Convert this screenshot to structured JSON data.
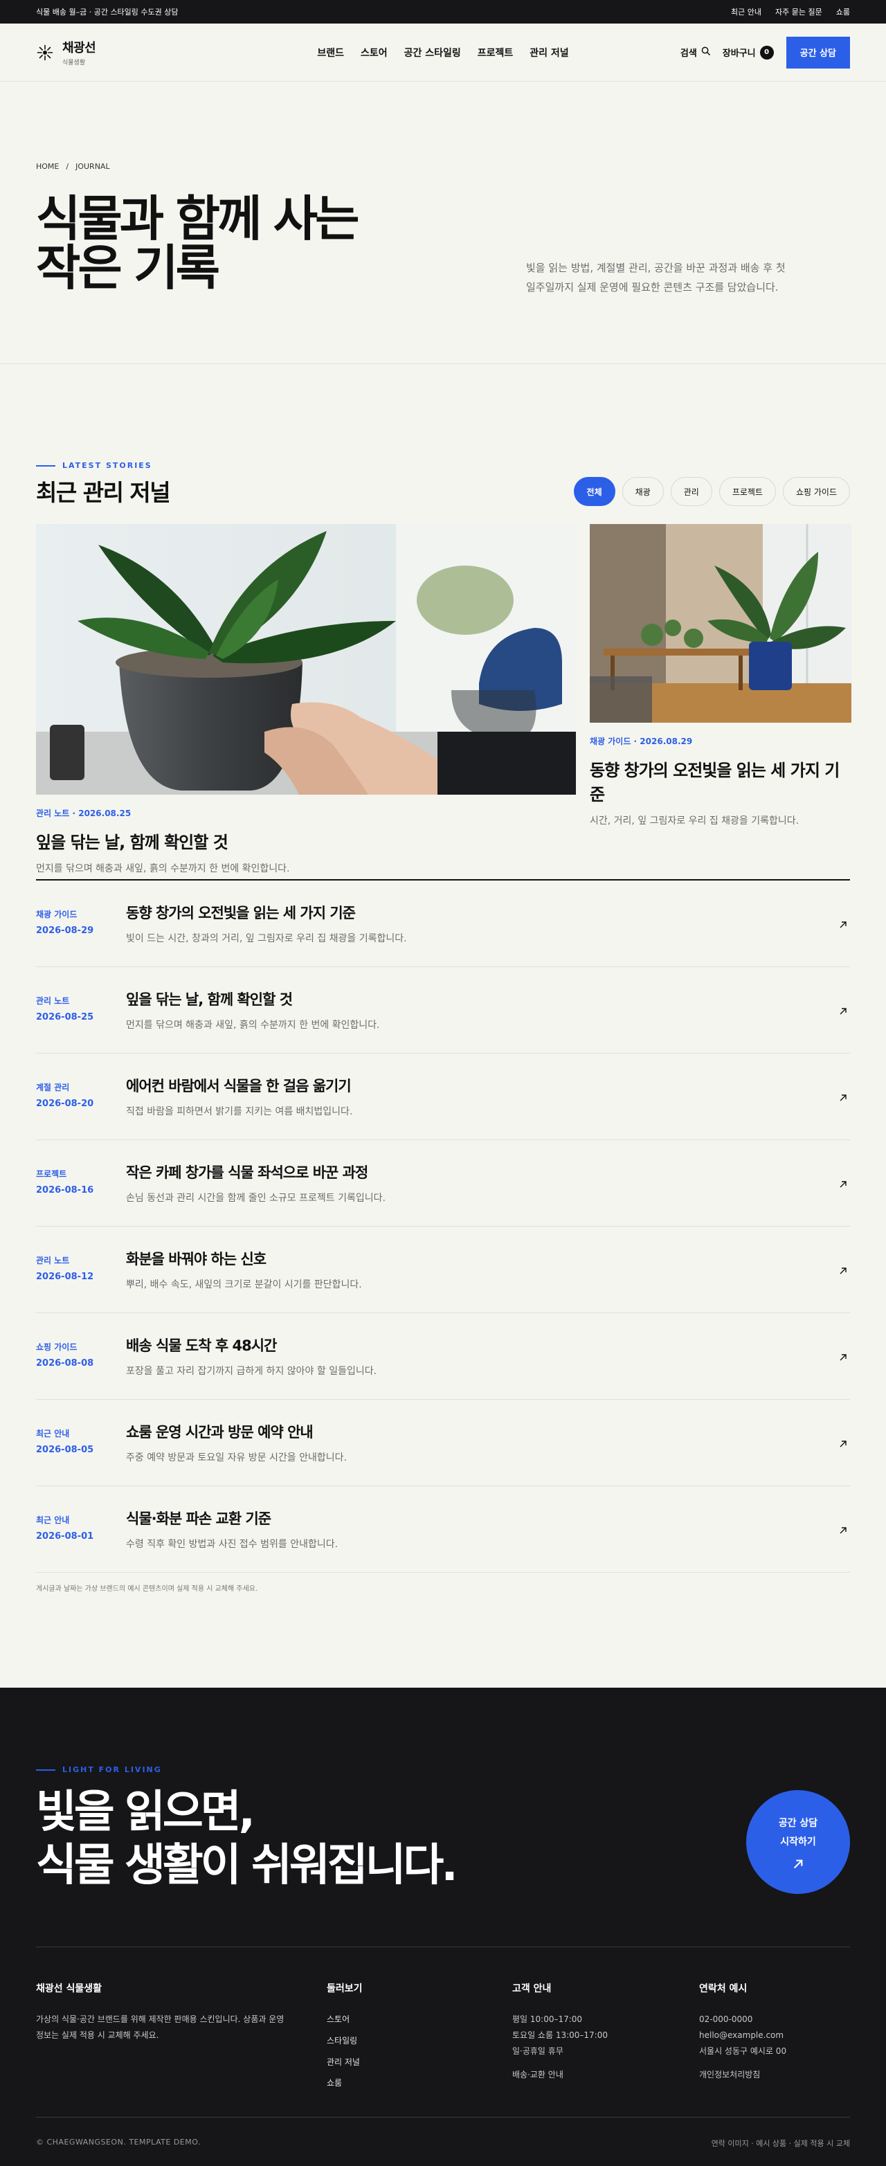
{
  "topbar": {
    "notice": "식물 배송 월–금 · 공간 스타일링 수도권 상담",
    "links": [
      "최근 안내",
      "자주 묻는 질문",
      "쇼룸"
    ]
  },
  "header": {
    "brand": "채광선",
    "brand_sub": "식물생활",
    "nav": [
      "브랜드",
      "스토어",
      "공간 스타일링",
      "프로젝트",
      "관리 저널"
    ],
    "search_label": "검색",
    "cart_label": "장바구니",
    "cart_count": "0",
    "cta": "공간 상담"
  },
  "hero": {
    "crumb_home": "HOME",
    "crumb_sep": "/",
    "crumb_current": "JOURNAL",
    "title_line1": "식물과 함께 사는",
    "title_line2": "작은 기록",
    "desc_line1": "빛을 읽는 방법, 계절별 관리, 공간을 바꾼 과정과 배송 후 첫",
    "desc_line2": "일주일까지 실제 운영에 필요한 콘텐츠 구조를 담았습니다."
  },
  "journal": {
    "eyebrow": "LATEST STORIES",
    "title": "최근 관리 저널",
    "filters": [
      "전체",
      "채광",
      "관리",
      "프로젝트",
      "쇼핑 가이드"
    ],
    "active_filter": "전체",
    "featured_main": {
      "meta": "관리 노트 · 2026.08.25",
      "title": "잎을 닦는 날, 함께 확인할 것",
      "desc": "먼지를 닦으며 해충과 새잎, 흙의 수분까지 한 번에 확인합니다."
    },
    "featured_side": {
      "meta": "채광 가이드 · 2026.08.29",
      "title": "동향 창가의 오전빛을 읽는 세 가지 기준",
      "desc": "시간, 거리, 잎 그림자로 우리 집 채광을 기록합니다."
    },
    "posts": [
      {
        "category": "채광 가이드",
        "date": "2026-08-29",
        "title": "동향 창가의 오전빛을 읽는 세 가지 기준",
        "desc": "빛이 드는 시간, 창과의 거리, 잎 그림자로 우리 집 채광을 기록합니다."
      },
      {
        "category": "관리 노트",
        "date": "2026-08-25",
        "title": "잎을 닦는 날, 함께 확인할 것",
        "desc": "먼지를 닦으며 해충과 새잎, 흙의 수분까지 한 번에 확인합니다."
      },
      {
        "category": "계절 관리",
        "date": "2026-08-20",
        "title": "에어컨 바람에서 식물을 한 걸음 옮기기",
        "desc": "직접 바람을 피하면서 밝기를 지키는 여름 배치법입니다."
      },
      {
        "category": "프로젝트",
        "date": "2026-08-16",
        "title": "작은 카페 창가를 식물 좌석으로 바꾼 과정",
        "desc": "손님 동선과 관리 시간을 함께 줄인 소규모 프로젝트 기록입니다."
      },
      {
        "category": "관리 노트",
        "date": "2026-08-12",
        "title": "화분을 바꿔야 하는 신호",
        "desc": "뿌리, 배수 속도, 새잎의 크기로 분갈이 시기를 판단합니다."
      },
      {
        "category": "쇼핑 가이드",
        "date": "2026-08-08",
        "title": "배송 식물 도착 후 48시간",
        "desc": "포장을 풀고 자리 잡기까지 급하게 하지 않아야 할 일들입니다."
      },
      {
        "category": "최근 안내",
        "date": "2026-08-05",
        "title": "쇼룸 운영 시간과 방문 예약 안내",
        "desc": "주중 예약 방문과 토요일 자유 방문 시간을 안내합니다."
      },
      {
        "category": "최근 안내",
        "date": "2026-08-01",
        "title": "식물·화분 파손 교환 기준",
        "desc": "수령 직후 확인 방법과 사진 접수 범위를 안내합니다."
      }
    ],
    "note": "게시글과 날짜는 가상 브랜드의 예시 콘텐츠이며 실제 적용 시 교체해 주세요."
  },
  "footer": {
    "eyebrow": "LIGHT FOR LIVING",
    "cta_line1": "빛을 읽으면,",
    "cta_line2": "식물 생활이 쉬워집니다.",
    "cta_button_line1": "공간 상담",
    "cta_button_line2": "시작하기",
    "brand_title": "채광선 식물생활",
    "brand_desc": "가상의 식물·공간 브랜드를 위해 제작한 판매용 스킨입니다. 상품과 운영 정보는 실제 적용 시 교체해 주세요.",
    "menu_title": "둘러보기",
    "menu": [
      "스토어",
      "스타일링",
      "관리 저널",
      "쇼룸"
    ],
    "cs_title": "고객 안내",
    "cs_lines": [
      "평일 10:00–17:00",
      "토요일 쇼룸 13:00–17:00",
      "일·공휴일 휴무"
    ],
    "cs_link": "배송·교환 안내",
    "contact_title": "연락처 예시",
    "contact_lines": [
      "02-000-0000",
      "hello@example.com",
      "서울시 성동구 예시로 00"
    ],
    "contact_link": "개인정보처리방침",
    "copyright": "© CHAEGWANGSEON. TEMPLATE DEMO.",
    "disclaimer": "연락 이미지 · 예시 상품 · 실제 적용 시 교체"
  },
  "colors": {
    "accent": "#2c5fe8",
    "dark": "#161618",
    "background": "#f5f5f0"
  }
}
